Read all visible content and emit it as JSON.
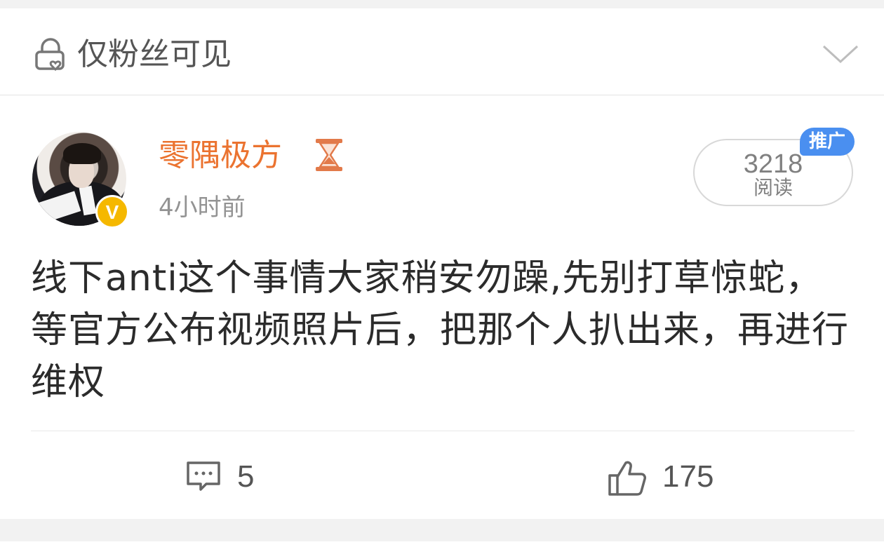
{
  "visibility": {
    "label": "仅粉丝可见",
    "icon": "lock-heart-icon"
  },
  "post": {
    "author": "零隅极方",
    "author_color": "#eb7330",
    "time": "4小时前",
    "read_count": "3218",
    "read_label": "阅读",
    "promo_badge": "推广",
    "promo_color": "#4a8ff0",
    "text": "线下anti这个事情大家稍安勿躁,先别打草惊蛇，等官方公布视频照片后，把那个人扒出来，再进行维权",
    "verified_badge": "V"
  },
  "actions": {
    "comments": "5",
    "likes": "175"
  }
}
